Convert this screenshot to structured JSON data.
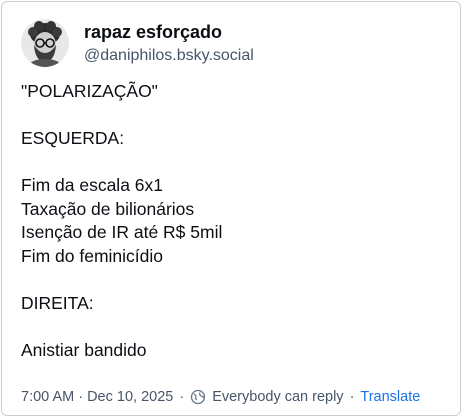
{
  "post": {
    "author": {
      "display_name": "rapaz esforçado",
      "handle": "@daniphilos.bsky.social",
      "avatar_icon": "avatar-photo"
    },
    "lines": [
      "\"POLARIZAÇÃO\"",
      "",
      "ESQUERDA:",
      "",
      "Fim da escala 6x1",
      "Taxação de bilionários",
      "Isenção de IR até R$ 5mil",
      "Fim do feminicídio",
      "",
      "DIREITA:",
      "",
      "Anistiar bandido"
    ],
    "timestamp": "7:00 AM · Dec 10, 2025",
    "reply_setting": "Everybody can reply",
    "separator": "·",
    "translate_label": "Translate"
  },
  "colors": {
    "text": "#0b0f14",
    "muted": "#475569",
    "link": "#1a73e8",
    "border": "#c9ced6"
  }
}
